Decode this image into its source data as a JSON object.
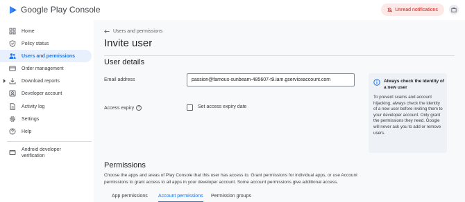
{
  "header": {
    "app_name": "Google Play Console",
    "notifications_label": "Unread notifications"
  },
  "sidebar": {
    "items": [
      {
        "label": "Home",
        "icon": "home-grid-icon"
      },
      {
        "label": "Policy status",
        "icon": "shield-icon"
      },
      {
        "label": "Users and permissions",
        "icon": "people-icon",
        "active": true
      },
      {
        "label": "Order management",
        "icon": "credit-card-icon"
      },
      {
        "label": "Download reports",
        "icon": "download-icon"
      },
      {
        "label": "Developer account",
        "icon": "account-icon"
      },
      {
        "label": "Activity log",
        "icon": "document-icon"
      },
      {
        "label": "Settings",
        "icon": "gear-icon"
      },
      {
        "label": "Help",
        "icon": "help-icon"
      }
    ],
    "footer_item": {
      "label": "Android developer verification",
      "icon": "laptop-icon"
    }
  },
  "main": {
    "breadcrumb": "Users and permissions",
    "title": "Invite user",
    "user_details": {
      "heading": "User details",
      "email_label": "Email address",
      "email_value": "passion@famous-sunbeam-485607-t9.iam.gserviceaccount.com",
      "expiry_label": "Access expiry",
      "expiry_checkbox_label": "Set access expiry date"
    },
    "info": {
      "title": "Always check the identity of a new user",
      "body": "To prevent scams and account hijacking, always check the identity of a new user before inviting them to your developer account. Only grant the permissions they need. Google will never ask you to add or remove users."
    },
    "permissions": {
      "heading": "Permissions",
      "description": "Choose the apps and areas of Play Console that this user has access to. Grant permissions for individual apps, or use Account permissions to grant access to all apps in your developer account. Some account permissions give additional access.",
      "tabs": [
        "App permissions",
        "Account permissions",
        "Permission groups"
      ],
      "active_tab": "Account permissions"
    }
  },
  "colors": {
    "accent": "#1a73e8",
    "active_bg": "#e8f0fe",
    "notification_bg": "#fce8e6",
    "notification_text": "#c5221f"
  }
}
